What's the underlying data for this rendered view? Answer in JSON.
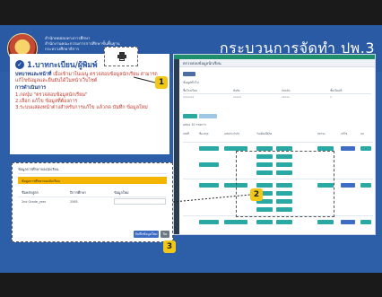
{
  "slide": {
    "org_lines": [
      "สำนักทดสอบทางการศึกษา",
      "สำนักงานคณะกรรมการการศึกษาขั้นพื้นฐาน",
      "กระทรวงศึกษาธิการ"
    ],
    "title": "กระบวนการจัดทำ ปพ.3"
  },
  "panel": {
    "step_title": "1.บาทกะเบียน/ผู้พิมพ์",
    "desc_label": "บทบาทและหน้าที่",
    "desc_text": "เมื่อเข้ามาในเมนู ตรวจสอบข้อมูลนักเรียน สามารถแก้ไขข้อมูลและยืนยันได้ในหน้าเว็บไซต์",
    "proc_label": "การดำเนินการ",
    "items": [
      "1.กดปุ่ม \"ตรวจสอบข้อมูลนักเรียน\"",
      "2.เลือก แก้ไข ข้อมูลที่ต้องการ",
      "3.ระบบแสดงหน้าต่างสำหรับการแก้ไข แล้วกด บันทึก ข้อมูลใหม่"
    ]
  },
  "callouts": {
    "one": "1",
    "two": "2",
    "three": "3"
  },
  "shot": {
    "title": "ตรวจสอบข้อมูลนักเรียน",
    "subtitle": "ข้อมูลทั่วไป",
    "head_cols": [
      "ชื่อโรงเรียน",
      "สังกัด",
      "จังหวัด",
      "ชั้นเรียนที่"
    ],
    "row_vals": [
      "xxxxxxx",
      "xxxxx",
      "xxxxx",
      "x"
    ],
    "small_label": "แสดง 10 รายการ",
    "grid_cols": [
      "เลขที่",
      "ชื่อ-สกุล",
      "เลขประจำตัว",
      "วันเดือนปีเกิด",
      "สถานะ",
      "แก้ไข",
      "ลบ"
    ]
  },
  "dialog": {
    "title": "ข้อมูลการศึกษาของนักเรียน",
    "band": "ข้อมูลการศึกษาของนักเรียน",
    "headers": [
      "ชื่อหลักสูตร",
      "ปีการศึกษา",
      "ข้อมูลใหม่"
    ],
    "row": [
      "2nd Grade_year",
      "2565"
    ],
    "save_label": "บันทึกข้อมูลใหม่",
    "close_label": "ปิด"
  },
  "colors": {
    "slide_blue": "#2d5fa8",
    "badge_yellow": "#f2c818",
    "band_orange": "#f4b400",
    "teal": "#2aa8a4"
  },
  "icons": {
    "print": "printer-icon",
    "check": "check-circle-icon",
    "logo": "school-emblem-logo"
  }
}
